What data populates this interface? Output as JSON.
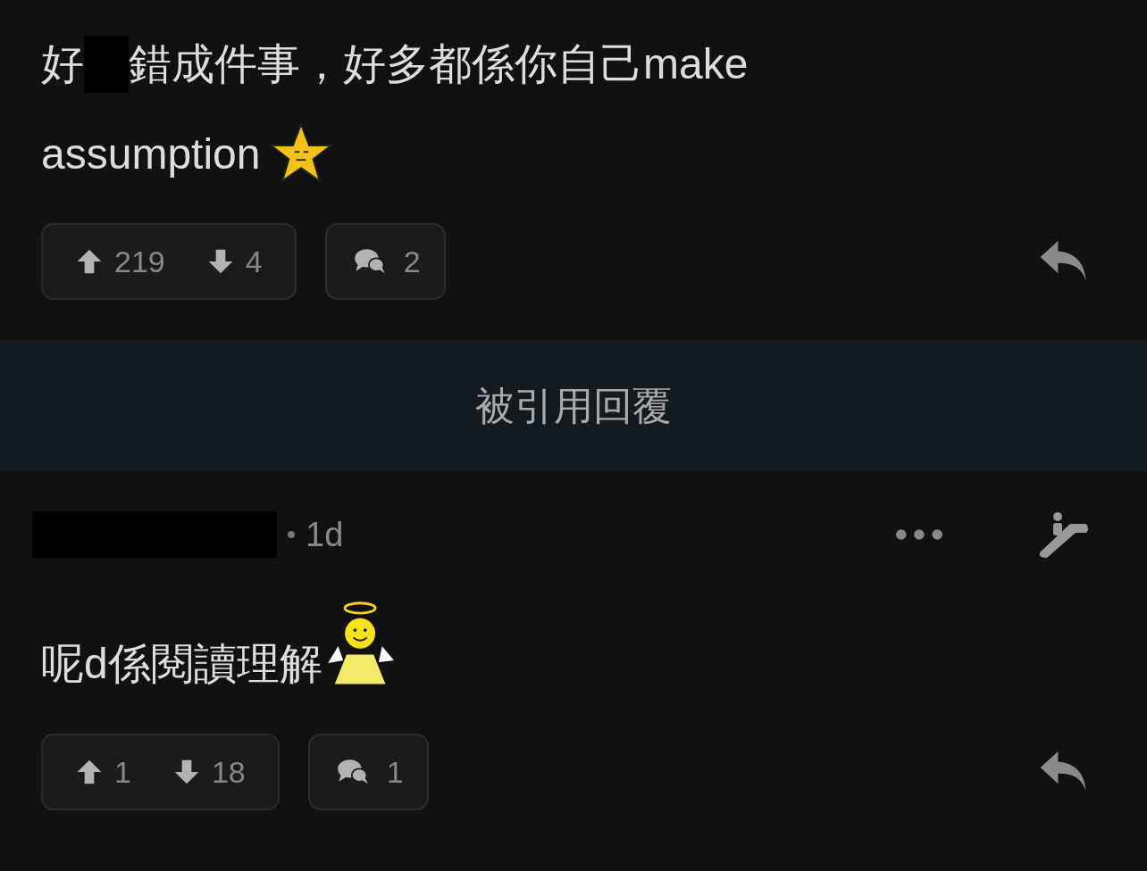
{
  "quoted_post": {
    "lines": [
      [
        {
          "kind": "text",
          "text": "好"
        },
        {
          "kind": "redacted"
        },
        {
          "kind": "text",
          "text": "錯成件事，好多都係你自己make"
        }
      ],
      [
        {
          "kind": "text",
          "text": "assumption"
        },
        {
          "kind": "star_emoji"
        }
      ]
    ],
    "upvotes": "219",
    "downvotes": "4",
    "comments": "2"
  },
  "banner": {
    "label": "被引用回覆"
  },
  "reply": {
    "author_redacted": true,
    "time": "1d",
    "lines": [
      [
        {
          "kind": "text",
          "text": "呢d係閱讀理解"
        },
        {
          "kind": "angel_emoji"
        }
      ]
    ],
    "upvotes": "1",
    "downvotes": "18",
    "comments": "1"
  }
}
